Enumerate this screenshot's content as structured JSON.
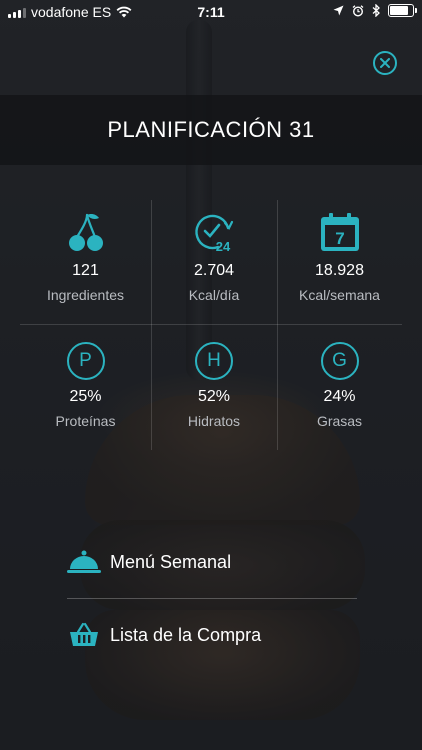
{
  "status_bar": {
    "carrier": "vodafone ES",
    "time": "7:11",
    "icons": [
      "signal-bars-icon",
      "wifi-icon",
      "location-arrow-icon",
      "alarm-icon",
      "bluetooth-icon",
      "battery-icon"
    ],
    "signal_bars_filled": 3,
    "battery_level": 0.9
  },
  "header": {
    "title": "PLANIFICACIÓN 31",
    "close_icon": "close-icon"
  },
  "stats": [
    {
      "icon": "cherries-icon",
      "value": "121",
      "label": "Ingredientes"
    },
    {
      "icon": "clock-24-icon",
      "value": "2.704",
      "label": "Kcal/día"
    },
    {
      "icon": "calendar-7-icon",
      "value": "18.928",
      "label": "Kcal/semana"
    },
    {
      "icon": "protein-p-icon",
      "letter": "P",
      "value": "25%",
      "label": "Proteínas"
    },
    {
      "icon": "carbs-h-icon",
      "letter": "H",
      "value": "52%",
      "label": "Hidratos"
    },
    {
      "icon": "fat-g-icon",
      "letter": "G",
      "value": "24%",
      "label": "Grasas"
    }
  ],
  "calendar_day": "7",
  "clock_badge": "24",
  "menu": [
    {
      "icon": "cloche-icon",
      "label": "Menú Semanal"
    },
    {
      "icon": "basket-icon",
      "label": "Lista de la Compra"
    }
  ],
  "colors": {
    "accent": "#2bb3c0",
    "text": "#ffffff",
    "muted": "#b9bcc1"
  }
}
